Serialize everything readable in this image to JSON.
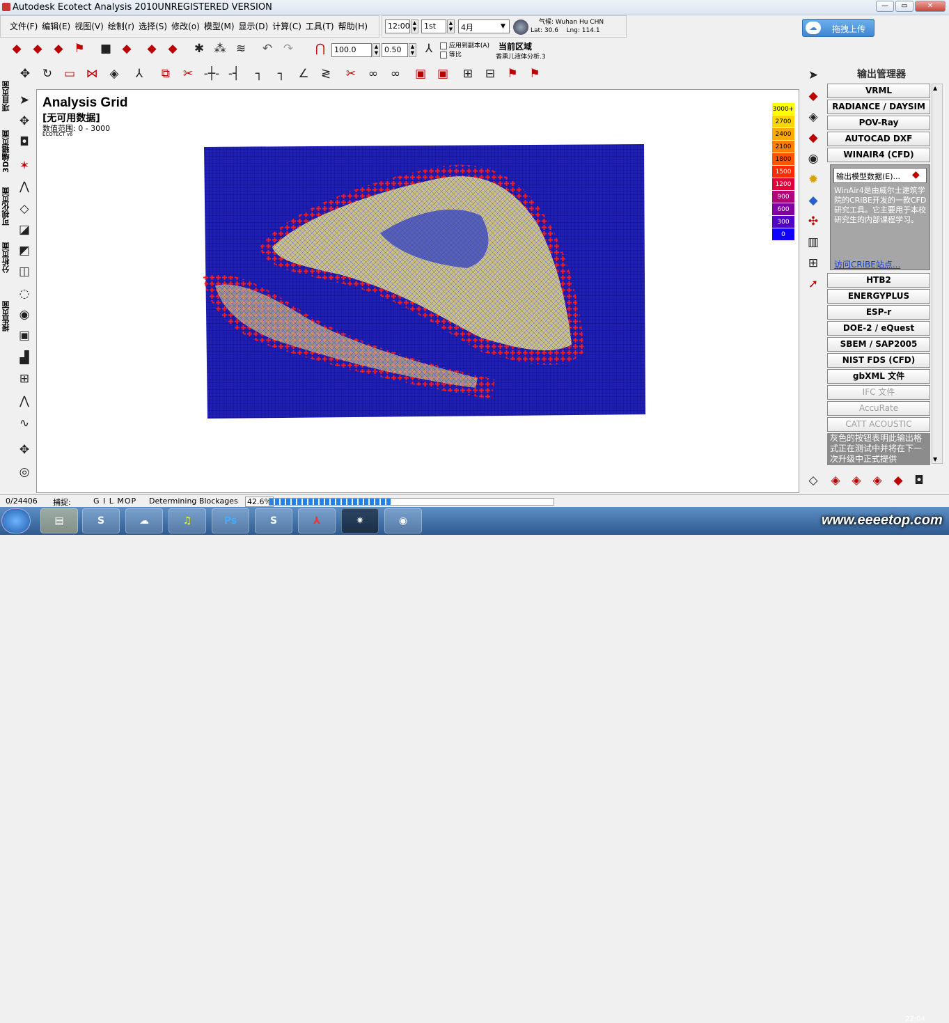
{
  "title": "Autodesk Ecotect Analysis 2010UNREGISTERED VERSION",
  "menu": [
    "文件(F)",
    "编辑(E)",
    "视图(V)",
    "绘制(r)",
    "选择(S)",
    "修改(o)",
    "模型(M)",
    "显示(D)",
    "计算(C)",
    "工具(T)",
    "帮助(H)"
  ],
  "controls": {
    "time": "12:00",
    "day": "1st",
    "month": "4月",
    "scale": "100.0",
    "ratio": "0.50",
    "chk1": "应用到副本(A)",
    "chk2": "等比",
    "zone_label": "当前区域",
    "zone_sub": "香熏儿液体分析.3"
  },
  "location": {
    "weather": "气候: Wuhan Hu CHN",
    "lat": "Lat: 30.6",
    "lng": "Lng: 114.1"
  },
  "upload": "拖拽上传",
  "left_tabs": [
    "项目页面",
    "3D编辑页面",
    "可视化页面",
    "分析页面",
    "报告页面"
  ],
  "viewport": {
    "title": "Analysis Grid",
    "subtitle": "[无可用数据]",
    "range": "数值范围: 0 - 3000",
    "brand": "ECOTECT v6"
  },
  "legend": [
    {
      "label": "3000+",
      "color": "#ffff00",
      "text": "#000"
    },
    {
      "label": "2700",
      "color": "#ffd500",
      "text": "#000"
    },
    {
      "label": "2400",
      "color": "#ffaa00",
      "text": "#000"
    },
    {
      "label": "2100",
      "color": "#ff8000",
      "text": "#000"
    },
    {
      "label": "1800",
      "color": "#ff5500",
      "text": "#000"
    },
    {
      "label": "1500",
      "color": "#ff2a00",
      "text": "#fff"
    },
    {
      "label": "1200",
      "color": "#e0003a",
      "text": "#fff"
    },
    {
      "label": "900",
      "color": "#b0007a",
      "text": "#fff"
    },
    {
      "label": "600",
      "color": "#8000a0",
      "text": "#fff"
    },
    {
      "label": "300",
      "color": "#5000c8",
      "text": "#fff"
    },
    {
      "label": "0",
      "color": "#1000ff",
      "text": "#fff"
    }
  ],
  "output_manager": {
    "title": "输出管理器",
    "buttons": [
      {
        "label": "VRML",
        "disabled": false
      },
      {
        "label": "RADIANCE / DAYSIM",
        "disabled": false
      },
      {
        "label": "POV-Ray",
        "disabled": false
      },
      {
        "label": "AUTOCAD DXF",
        "disabled": false
      },
      {
        "label": "WINAIR4 (CFD)",
        "disabled": false
      },
      {
        "label": "HTB2",
        "disabled": false
      },
      {
        "label": "ENERGYPLUS",
        "disabled": false
      },
      {
        "label": "ESP-r",
        "disabled": false
      },
      {
        "label": "DOE-2 / eQuest",
        "disabled": false
      },
      {
        "label": "SBEM / SAP2005",
        "disabled": false
      },
      {
        "label": "NIST FDS (CFD)",
        "disabled": false
      },
      {
        "label": "gbXML 文件",
        "disabled": false
      },
      {
        "label": "IFC 文件",
        "disabled": true
      },
      {
        "label": "AccuRate",
        "disabled": true
      },
      {
        "label": "CATT ACOUSTIC",
        "disabled": true
      }
    ],
    "export_label": "输出模型数据(E)...",
    "winair_text": "WinAir4是由威尔士建筑学院的CRiBE开发的一款CFD研究工具。它主要用于本校研究生的内部课程学习。",
    "link": "访问CRiBE站点...",
    "gray_note": "灰色的按钮表明此输出格式正在测试中并将在下一次升级中正式提供"
  },
  "status": {
    "count": "0/24406",
    "snap_label": "捕捉:",
    "snap_vals": "G I  L  MOP",
    "task": "Determining Blockages",
    "percent": "42.6%",
    "progress": 0.426
  },
  "watermark": "www.eeeetop.com",
  "clock": "22:04"
}
